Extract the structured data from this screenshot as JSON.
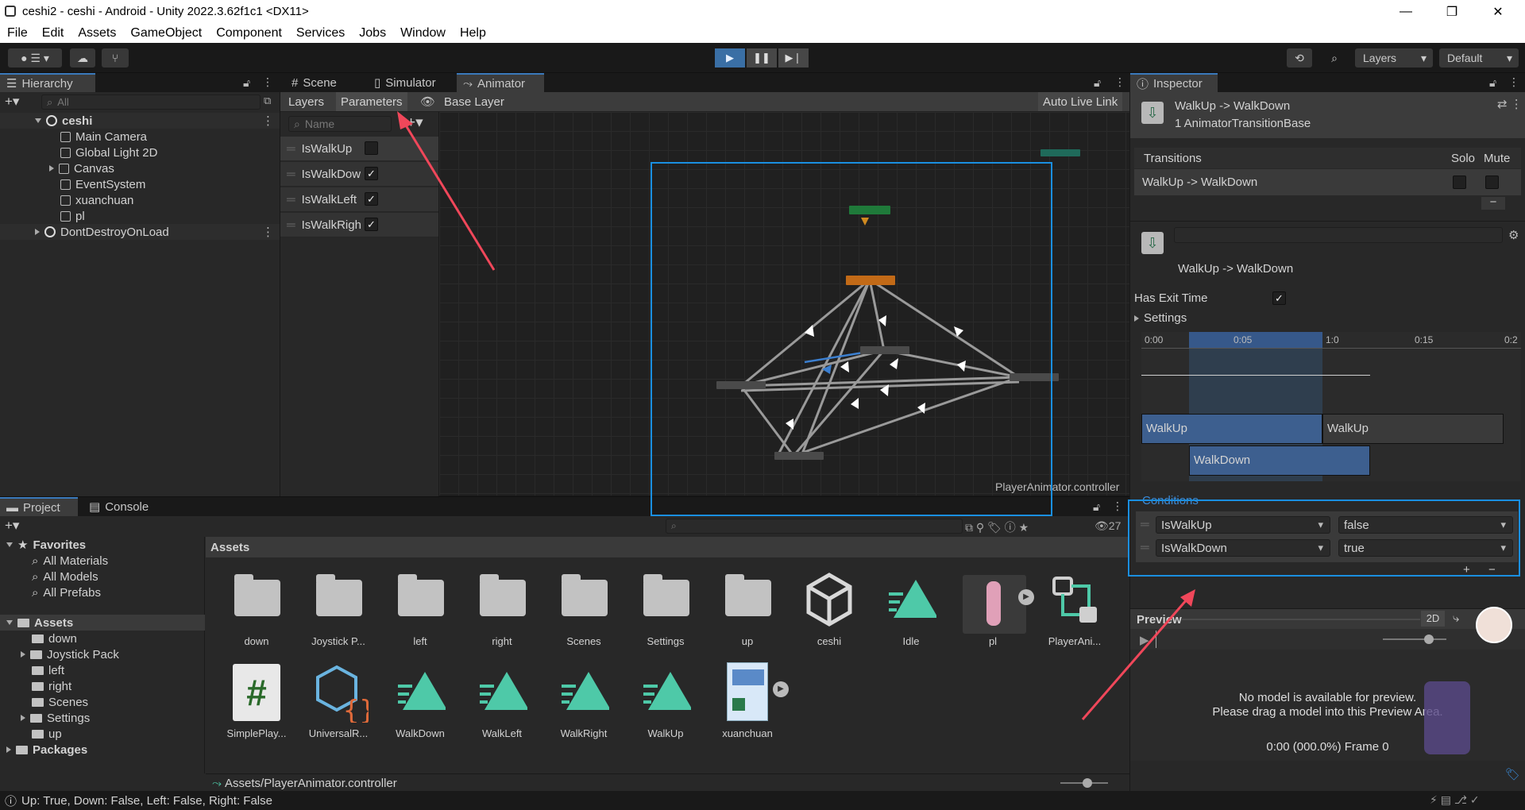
{
  "window": {
    "title": "ceshi2 - ceshi - Android - Unity 2022.3.62f1c1 <DX11>"
  },
  "menu": [
    "File",
    "Edit",
    "Assets",
    "GameObject",
    "Component",
    "Services",
    "Jobs",
    "Window",
    "Help"
  ],
  "toolbar": {
    "layers_label": "Layers",
    "layout_label": "Default"
  },
  "hierarchy": {
    "tab": "Hierarchy",
    "search_placeholder": "All",
    "scene": "ceshi",
    "items": [
      "Main Camera",
      "Global Light 2D",
      "Canvas",
      "EventSystem",
      "xuanchuan",
      "pl"
    ],
    "dontdestroy": "DontDestroyOnLoad"
  },
  "center_tabs": [
    "Scene",
    "Simulator",
    "Animator"
  ],
  "animator": {
    "layers_tab": "Layers",
    "parameters_tab": "Parameters",
    "base_layer": "Base Layer",
    "auto_live_link": "Auto Live Link",
    "search_placeholder": "Name",
    "params": [
      {
        "name": "IsWalkUp",
        "checked": false
      },
      {
        "name": "IsWalkDow",
        "checked": true
      },
      {
        "name": "IsWalkLeft",
        "checked": true
      },
      {
        "name": "IsWalkRigh",
        "checked": true
      }
    ],
    "controller": "PlayerAnimator.controller"
  },
  "inspector": {
    "tab": "Inspector",
    "header_title": "WalkUp -> WalkDown",
    "header_sub": "1 AnimatorTransitionBase",
    "transitions_label": "Transitions",
    "solo_label": "Solo",
    "mute_label": "Mute",
    "transition_row": "WalkUp -> WalkDown",
    "transition_name": "WalkUp -> WalkDown",
    "has_exit_time_label": "Has Exit Time",
    "has_exit_time": true,
    "settings_label": "Settings",
    "timeline_ticks": [
      "0:00",
      "0:05",
      "1:0",
      "0:15",
      "0:2"
    ],
    "clip_a": "WalkUp",
    "clip_a2": "WalkUp",
    "clip_b": "WalkDown",
    "conditions_label": "Conditions",
    "conditions": [
      {
        "param": "IsWalkUp",
        "value": "false"
      },
      {
        "param": "IsWalkDown",
        "value": "true"
      }
    ],
    "preview_label": "Preview",
    "preview_2d": "2D",
    "preview_msg1": "No model is available for preview.",
    "preview_msg2": "Please drag a model into this Preview Area.",
    "preview_time": "0:00 (000.0%) Frame 0"
  },
  "project": {
    "tabs": [
      "Project",
      "Console"
    ],
    "count": "27",
    "favorites": "Favorites",
    "fav_items": [
      "All Materials",
      "All Models",
      "All Prefabs"
    ],
    "assets_root": "Assets",
    "tree": [
      "down",
      "Joystick Pack",
      "left",
      "right",
      "Scenes",
      "Settings",
      "up"
    ],
    "packages": "Packages",
    "assets_header": "Assets",
    "assets_row1": [
      "down",
      "Joystick P...",
      "left",
      "right",
      "Scenes",
      "Settings",
      "up",
      "ceshi",
      "Idle",
      "pl",
      "PlayerAni..."
    ],
    "assets_row2": [
      "SimplePlay...",
      "UniversalR...",
      "WalkDown",
      "WalkLeft",
      "WalkRight",
      "WalkUp",
      "xuanchuan"
    ],
    "path": "Assets/PlayerAnimator.controller"
  },
  "status": "Up: True, Down: False, Left: False, Right: False",
  "colors": {
    "accent": "#3a79bb",
    "highlight_box": "#1a8fe0",
    "arrow": "#f0475a",
    "entry": "#1f7a3a",
    "default_state": "#c26a17"
  }
}
